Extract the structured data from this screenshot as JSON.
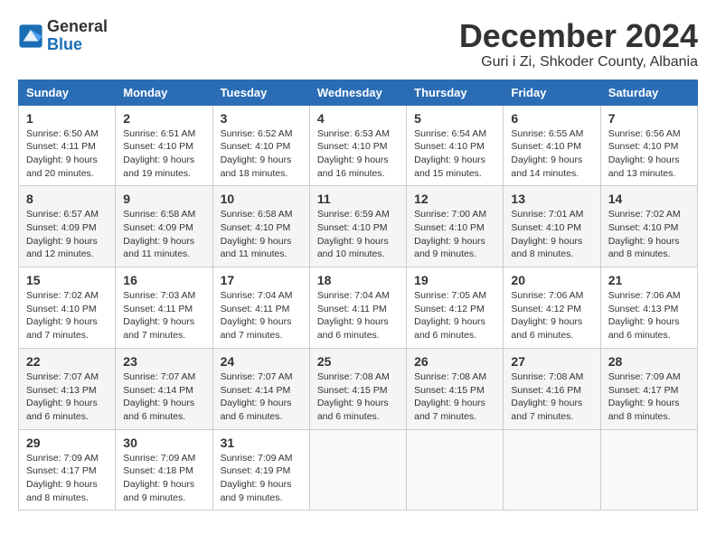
{
  "header": {
    "logo_line1": "General",
    "logo_line2": "Blue",
    "month_title": "December 2024",
    "location": "Guri i Zi, Shkoder County, Albania"
  },
  "columns": [
    "Sunday",
    "Monday",
    "Tuesday",
    "Wednesday",
    "Thursday",
    "Friday",
    "Saturday"
  ],
  "weeks": [
    [
      {
        "day": "1",
        "sunrise": "Sunrise: 6:50 AM",
        "sunset": "Sunset: 4:11 PM",
        "daylight": "Daylight: 9 hours and 20 minutes."
      },
      {
        "day": "2",
        "sunrise": "Sunrise: 6:51 AM",
        "sunset": "Sunset: 4:10 PM",
        "daylight": "Daylight: 9 hours and 19 minutes."
      },
      {
        "day": "3",
        "sunrise": "Sunrise: 6:52 AM",
        "sunset": "Sunset: 4:10 PM",
        "daylight": "Daylight: 9 hours and 18 minutes."
      },
      {
        "day": "4",
        "sunrise": "Sunrise: 6:53 AM",
        "sunset": "Sunset: 4:10 PM",
        "daylight": "Daylight: 9 hours and 16 minutes."
      },
      {
        "day": "5",
        "sunrise": "Sunrise: 6:54 AM",
        "sunset": "Sunset: 4:10 PM",
        "daylight": "Daylight: 9 hours and 15 minutes."
      },
      {
        "day": "6",
        "sunrise": "Sunrise: 6:55 AM",
        "sunset": "Sunset: 4:10 PM",
        "daylight": "Daylight: 9 hours and 14 minutes."
      },
      {
        "day": "7",
        "sunrise": "Sunrise: 6:56 AM",
        "sunset": "Sunset: 4:10 PM",
        "daylight": "Daylight: 9 hours and 13 minutes."
      }
    ],
    [
      {
        "day": "8",
        "sunrise": "Sunrise: 6:57 AM",
        "sunset": "Sunset: 4:09 PM",
        "daylight": "Daylight: 9 hours and 12 minutes."
      },
      {
        "day": "9",
        "sunrise": "Sunrise: 6:58 AM",
        "sunset": "Sunset: 4:09 PM",
        "daylight": "Daylight: 9 hours and 11 minutes."
      },
      {
        "day": "10",
        "sunrise": "Sunrise: 6:58 AM",
        "sunset": "Sunset: 4:10 PM",
        "daylight": "Daylight: 9 hours and 11 minutes."
      },
      {
        "day": "11",
        "sunrise": "Sunrise: 6:59 AM",
        "sunset": "Sunset: 4:10 PM",
        "daylight": "Daylight: 9 hours and 10 minutes."
      },
      {
        "day": "12",
        "sunrise": "Sunrise: 7:00 AM",
        "sunset": "Sunset: 4:10 PM",
        "daylight": "Daylight: 9 hours and 9 minutes."
      },
      {
        "day": "13",
        "sunrise": "Sunrise: 7:01 AM",
        "sunset": "Sunset: 4:10 PM",
        "daylight": "Daylight: 9 hours and 8 minutes."
      },
      {
        "day": "14",
        "sunrise": "Sunrise: 7:02 AM",
        "sunset": "Sunset: 4:10 PM",
        "daylight": "Daylight: 9 hours and 8 minutes."
      }
    ],
    [
      {
        "day": "15",
        "sunrise": "Sunrise: 7:02 AM",
        "sunset": "Sunset: 4:10 PM",
        "daylight": "Daylight: 9 hours and 7 minutes."
      },
      {
        "day": "16",
        "sunrise": "Sunrise: 7:03 AM",
        "sunset": "Sunset: 4:11 PM",
        "daylight": "Daylight: 9 hours and 7 minutes."
      },
      {
        "day": "17",
        "sunrise": "Sunrise: 7:04 AM",
        "sunset": "Sunset: 4:11 PM",
        "daylight": "Daylight: 9 hours and 7 minutes."
      },
      {
        "day": "18",
        "sunrise": "Sunrise: 7:04 AM",
        "sunset": "Sunset: 4:11 PM",
        "daylight": "Daylight: 9 hours and 6 minutes."
      },
      {
        "day": "19",
        "sunrise": "Sunrise: 7:05 AM",
        "sunset": "Sunset: 4:12 PM",
        "daylight": "Daylight: 9 hours and 6 minutes."
      },
      {
        "day": "20",
        "sunrise": "Sunrise: 7:06 AM",
        "sunset": "Sunset: 4:12 PM",
        "daylight": "Daylight: 9 hours and 6 minutes."
      },
      {
        "day": "21",
        "sunrise": "Sunrise: 7:06 AM",
        "sunset": "Sunset: 4:13 PM",
        "daylight": "Daylight: 9 hours and 6 minutes."
      }
    ],
    [
      {
        "day": "22",
        "sunrise": "Sunrise: 7:07 AM",
        "sunset": "Sunset: 4:13 PM",
        "daylight": "Daylight: 9 hours and 6 minutes."
      },
      {
        "day": "23",
        "sunrise": "Sunrise: 7:07 AM",
        "sunset": "Sunset: 4:14 PM",
        "daylight": "Daylight: 9 hours and 6 minutes."
      },
      {
        "day": "24",
        "sunrise": "Sunrise: 7:07 AM",
        "sunset": "Sunset: 4:14 PM",
        "daylight": "Daylight: 9 hours and 6 minutes."
      },
      {
        "day": "25",
        "sunrise": "Sunrise: 7:08 AM",
        "sunset": "Sunset: 4:15 PM",
        "daylight": "Daylight: 9 hours and 6 minutes."
      },
      {
        "day": "26",
        "sunrise": "Sunrise: 7:08 AM",
        "sunset": "Sunset: 4:15 PM",
        "daylight": "Daylight: 9 hours and 7 minutes."
      },
      {
        "day": "27",
        "sunrise": "Sunrise: 7:08 AM",
        "sunset": "Sunset: 4:16 PM",
        "daylight": "Daylight: 9 hours and 7 minutes."
      },
      {
        "day": "28",
        "sunrise": "Sunrise: 7:09 AM",
        "sunset": "Sunset: 4:17 PM",
        "daylight": "Daylight: 9 hours and 8 minutes."
      }
    ],
    [
      {
        "day": "29",
        "sunrise": "Sunrise: 7:09 AM",
        "sunset": "Sunset: 4:17 PM",
        "daylight": "Daylight: 9 hours and 8 minutes."
      },
      {
        "day": "30",
        "sunrise": "Sunrise: 7:09 AM",
        "sunset": "Sunset: 4:18 PM",
        "daylight": "Daylight: 9 hours and 9 minutes."
      },
      {
        "day": "31",
        "sunrise": "Sunrise: 7:09 AM",
        "sunset": "Sunset: 4:19 PM",
        "daylight": "Daylight: 9 hours and 9 minutes."
      },
      null,
      null,
      null,
      null
    ]
  ]
}
